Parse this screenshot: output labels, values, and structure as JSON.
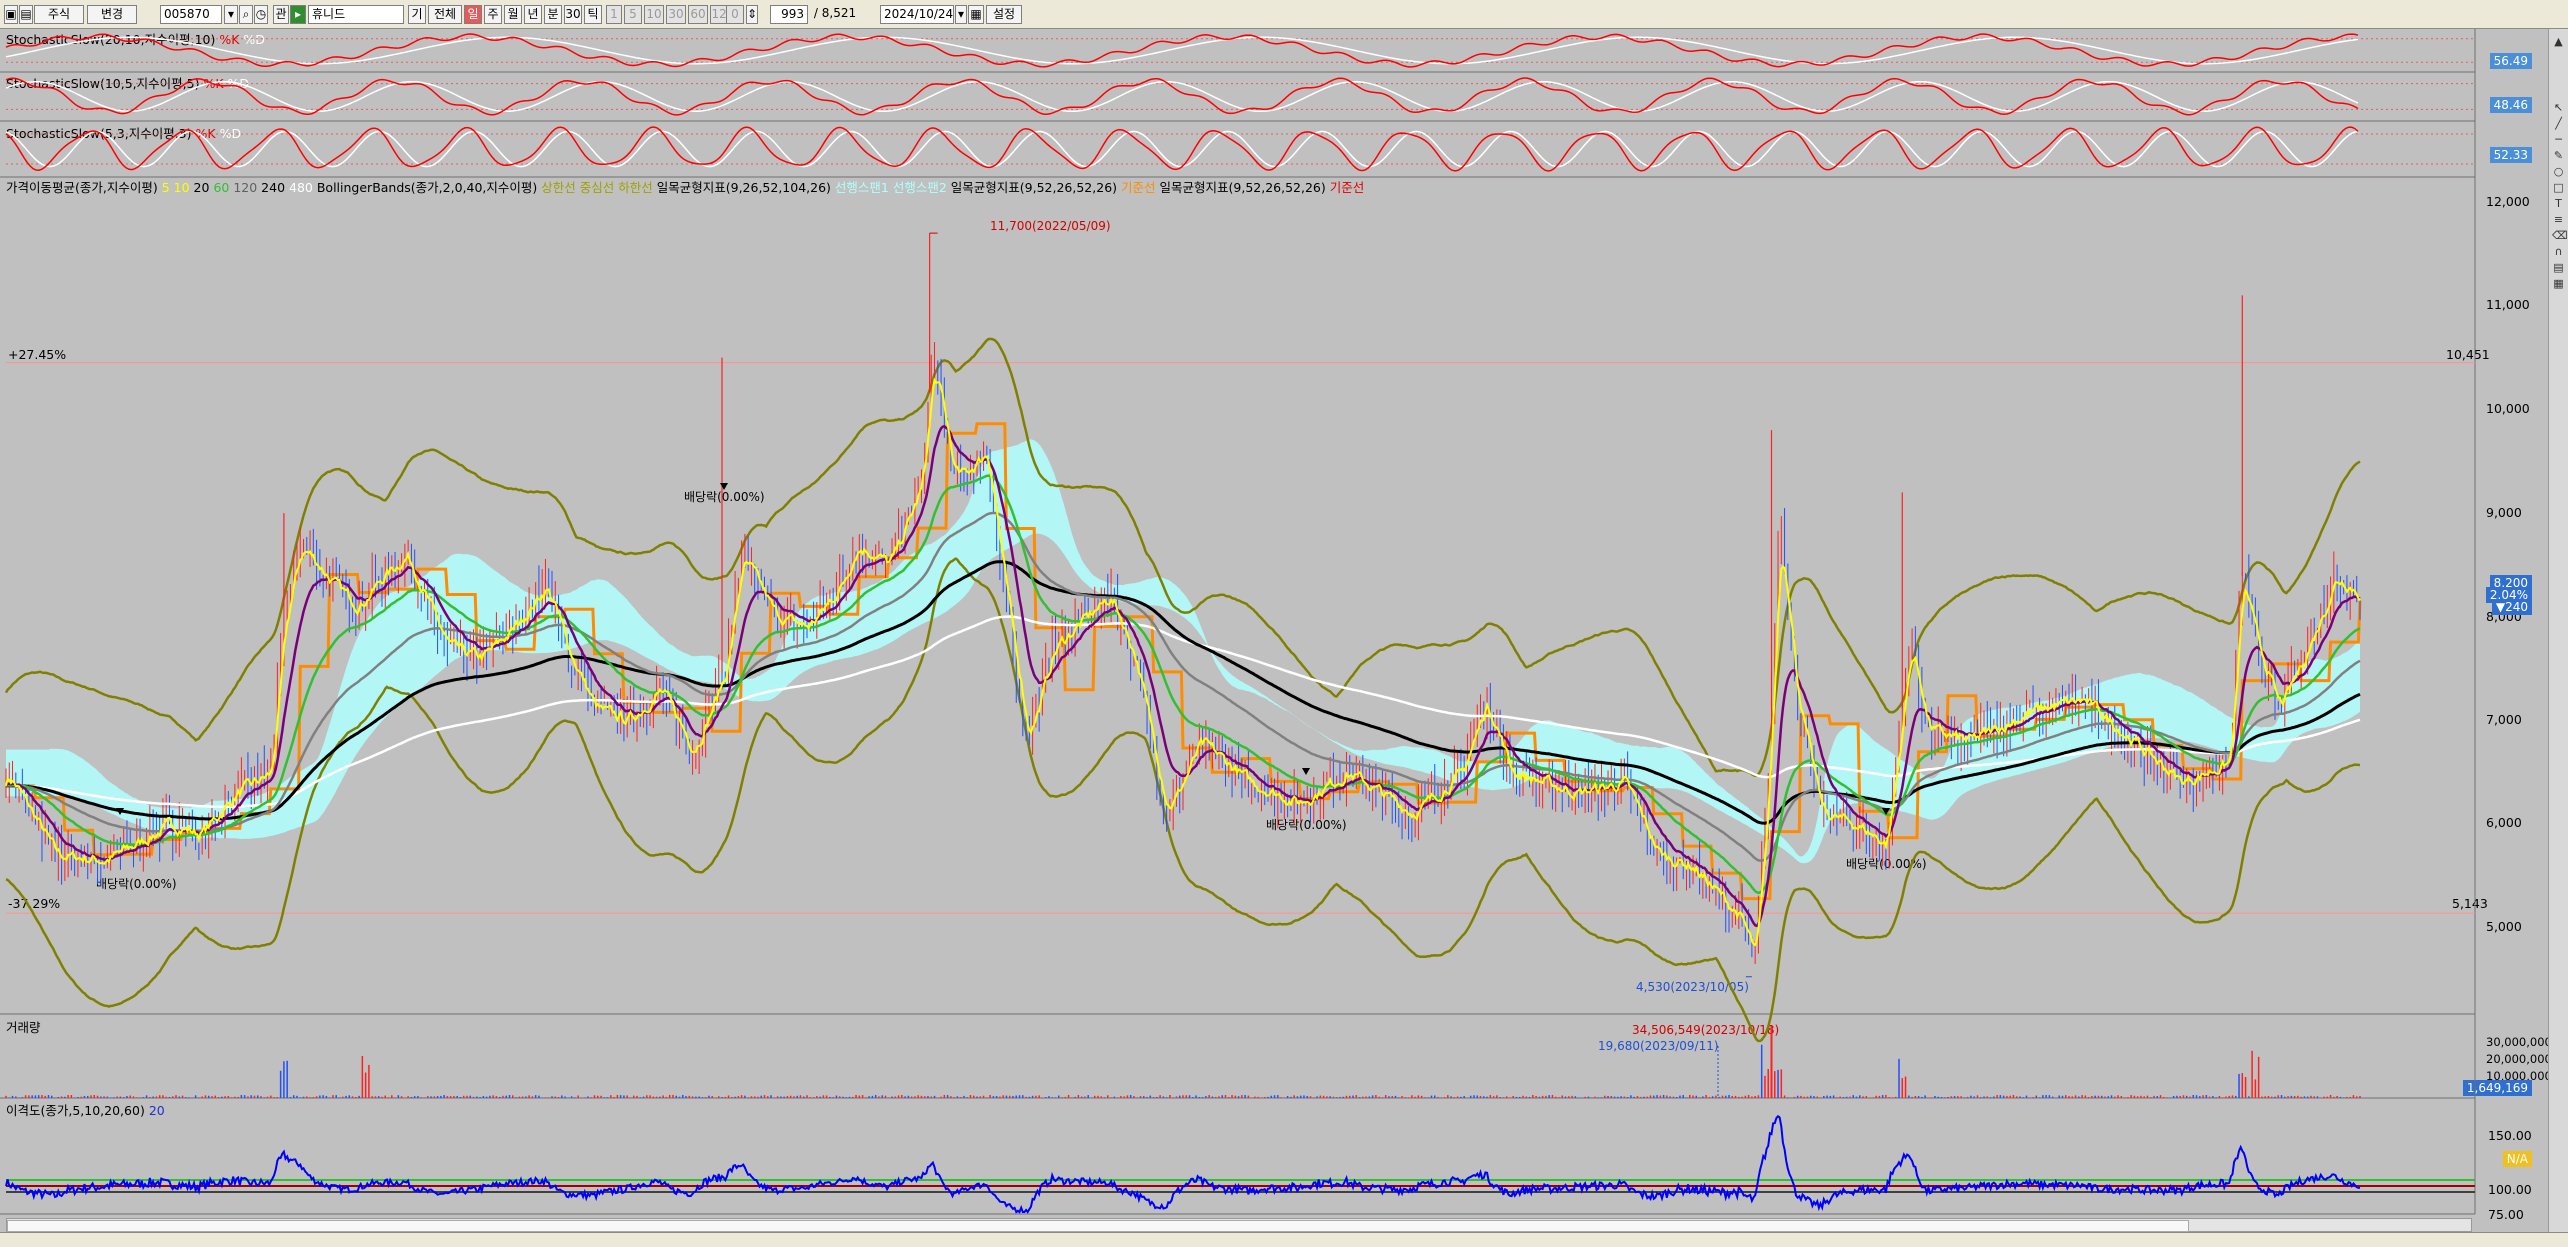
{
  "toolbar": {
    "market": "주식",
    "mode": "변경",
    "code": "005870",
    "name": "휴니드",
    "btn_gi": "기",
    "btn_all": "전체",
    "period_active": "일",
    "period_week": "주",
    "period_month": "월",
    "period_year": "년",
    "period_minute": "분",
    "period_30": "30",
    "period_tick": "틱",
    "dim_1": "1",
    "dim_5": "5",
    "dim_10": "10",
    "dim_30": "30",
    "dim_60": "60",
    "dim_120": "120",
    "dim_0": "0",
    "count": "993",
    "total": "/ 8,521",
    "date": "2024/10/24",
    "settings": "설정"
  },
  "indicators": {
    "stoch1": {
      "name": "StochasticSlow(20,10,지수이평,10)",
      "k": "%K",
      "d": "%D",
      "value": "56.49"
    },
    "stoch2": {
      "name": "StochasticSlow(10,5,지수이평,5)",
      "k": "%K",
      "d": "%D",
      "value": "48.46"
    },
    "stoch3": {
      "name": "StochasticSlow(5,3,지수이평,3)",
      "k": "%K",
      "d": "%D",
      "value": "52.33"
    }
  },
  "main_legend": {
    "ma": "가격이동평균(종가,지수이평)",
    "ma_p5": "5",
    "ma_p10": "10",
    "ma_p20": "20",
    "ma_p60": "60",
    "ma_p120": "120",
    "ma_p240": "240",
    "ma_p480": "480",
    "bb": "BollingerBands(종가,2,0,40,지수이평)",
    "bb_upper": "상한선",
    "bb_mid": "중심선",
    "bb_lower": "하한선",
    "ichi1": "일목균형지표(9,26,52,104,26)",
    "ichi1_span1": "선행스팬1",
    "ichi1_span2": "선행스팬2",
    "ichi2": "일목균형지표(9,52,26,52,26)",
    "ichi2_line": "기준선",
    "ichi3": "일목균형지표(9,52,26,52,26)",
    "ichi3_line": "기준선"
  },
  "price_axis": {
    "ticks": [
      "12,000",
      "11,000",
      "10,000",
      "9,000",
      "8,000",
      "7,000",
      "6,000",
      "5,000"
    ],
    "current": "8,200",
    "change_pct": "2.04%",
    "change": "▼240"
  },
  "range_lines": {
    "upper_pct": "+27.45%",
    "upper_price": "10,451",
    "lower_pct": "-37.29%",
    "lower_price": "5,143"
  },
  "annotations": {
    "high": "11,700(2022/05/09)",
    "low": "4,530(2023/10/05)",
    "div1": "배당락(0.00%)",
    "div2": "배당락(0.00%)",
    "div3": "배당락(0.00%)",
    "div4": "배당락(0.00%)"
  },
  "volume": {
    "title": "거래량",
    "high": "34,506,549(2023/10/18)",
    "low": "19,680(2023/09/11)",
    "ticks": [
      "30,000,000",
      "20,000,000",
      "10,000,000"
    ],
    "current": "1,649,169"
  },
  "disparity": {
    "title": "이격도(종가,5,10,20,60)",
    "period": "20",
    "ticks": [
      "150.00",
      "100.00",
      "75.00"
    ],
    "value": "N/A"
  },
  "colors": {
    "candle_up": "#ff2020",
    "candle_down": "#2050ff",
    "ma5": "#ffff00",
    "ma10": "#7a007a",
    "ma20": "#30c030",
    "ma60": "#808080",
    "ma120": "#000000",
    "ma240": "#ffffff",
    "bollinger": "#808000",
    "kijun": "#ff8c00",
    "cloud": "#b0ffff",
    "stoch_k": "#ff0000",
    "stoch_d": "#ffffff",
    "disparity": "#0000ff"
  },
  "chart_data": {
    "type": "line",
    "series": [
      {
        "name": "%K",
        "values": [
          56.49
        ]
      },
      {
        "name": "%K",
        "values": [
          48.46
        ]
      },
      {
        "name": "%K",
        "values": [
          52.33
        ]
      }
    ],
    "price_path": [
      [
        0,
        6500
      ],
      [
        30,
        5700
      ],
      [
        60,
        5650
      ],
      [
        100,
        6000
      ],
      [
        118,
        5900
      ],
      [
        140,
        6300
      ],
      [
        162,
        6500
      ],
      [
        170,
        8000
      ],
      [
        180,
        8700
      ],
      [
        200,
        8300
      ],
      [
        215,
        8100
      ],
      [
        230,
        8400
      ],
      [
        245,
        8600
      ],
      [
        255,
        8200
      ],
      [
        270,
        7700
      ],
      [
        290,
        7600
      ],
      [
        310,
        7900
      ],
      [
        330,
        8300
      ],
      [
        345,
        7600
      ],
      [
        360,
        7100
      ],
      [
        380,
        7000
      ],
      [
        400,
        7300
      ],
      [
        420,
        6700
      ],
      [
        440,
        7500
      ],
      [
        450,
        8600
      ],
      [
        470,
        8000
      ],
      [
        490,
        7900
      ],
      [
        510,
        8300
      ],
      [
        520,
        8700
      ],
      [
        540,
        8500
      ],
      [
        560,
        9300
      ],
      [
        567,
        10500
      ],
      [
        580,
        9300
      ],
      [
        600,
        9600
      ],
      [
        610,
        8300
      ],
      [
        625,
        6800
      ],
      [
        640,
        7700
      ],
      [
        660,
        8000
      ],
      [
        675,
        8200
      ],
      [
        690,
        7600
      ],
      [
        710,
        6100
      ],
      [
        730,
        6800
      ],
      [
        760,
        6400
      ],
      [
        790,
        6200
      ],
      [
        820,
        6500
      ],
      [
        860,
        6100
      ],
      [
        890,
        6500
      ],
      [
        905,
        7200
      ],
      [
        920,
        6500
      ],
      [
        960,
        6300
      ],
      [
        990,
        6400
      ],
      [
        1010,
        5700
      ],
      [
        1030,
        5600
      ],
      [
        1060,
        5100
      ],
      [
        1070,
        4700
      ],
      [
        1078,
        6500
      ],
      [
        1085,
        9000
      ],
      [
        1095,
        7200
      ],
      [
        1110,
        6100
      ],
      [
        1130,
        6000
      ],
      [
        1150,
        5800
      ],
      [
        1165,
        7800
      ],
      [
        1175,
        6900
      ],
      [
        1200,
        6800
      ],
      [
        1240,
        7100
      ],
      [
        1270,
        7200
      ],
      [
        1300,
        6800
      ],
      [
        1330,
        6400
      ],
      [
        1360,
        6600
      ],
      [
        1368,
        8500
      ],
      [
        1375,
        7800
      ],
      [
        1390,
        7100
      ],
      [
        1410,
        7800
      ],
      [
        1425,
        8400
      ],
      [
        1440,
        8200
      ]
    ]
  }
}
